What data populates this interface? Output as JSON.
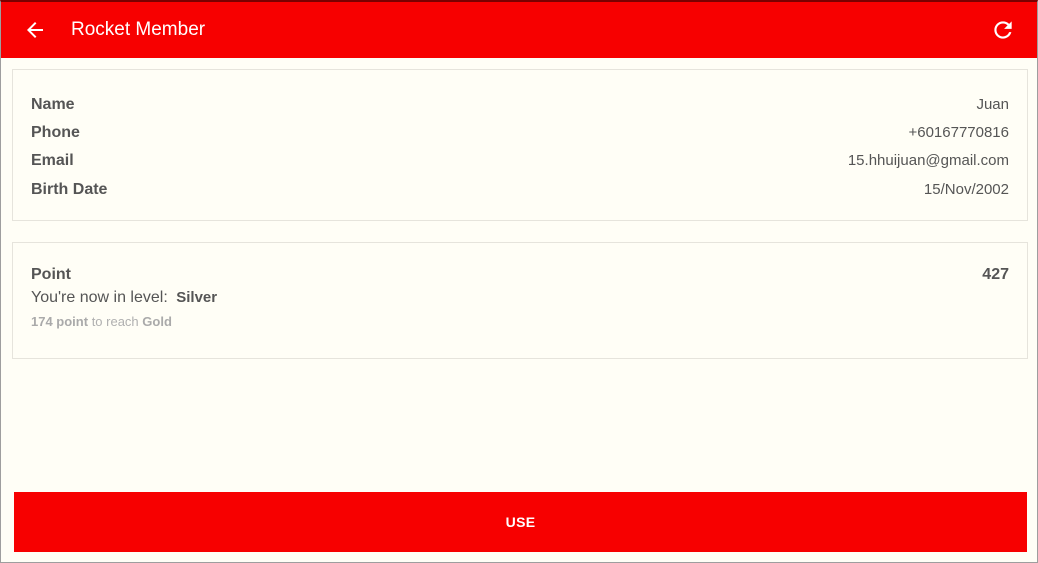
{
  "appbar": {
    "title": "Rocket Member",
    "back_icon": "arrow-left-icon",
    "refresh_icon": "refresh-icon",
    "color": "#f70000"
  },
  "profile": {
    "name_label": "Name",
    "name_value": "Juan",
    "phone_label": "Phone",
    "phone_value": "+60167770816",
    "email_label": "Email",
    "email_value": "15.hhuijuan@gmail.com",
    "birth_label": "Birth Date",
    "birth_value": "15/Nov/2002"
  },
  "points": {
    "label": "Point",
    "value": "427",
    "level_prefix": "You're now in level:",
    "level_name": "Silver",
    "reach_amount": "174 point",
    "reach_text": " to reach ",
    "next_level": "Gold"
  },
  "actions": {
    "use_label": "USE"
  }
}
